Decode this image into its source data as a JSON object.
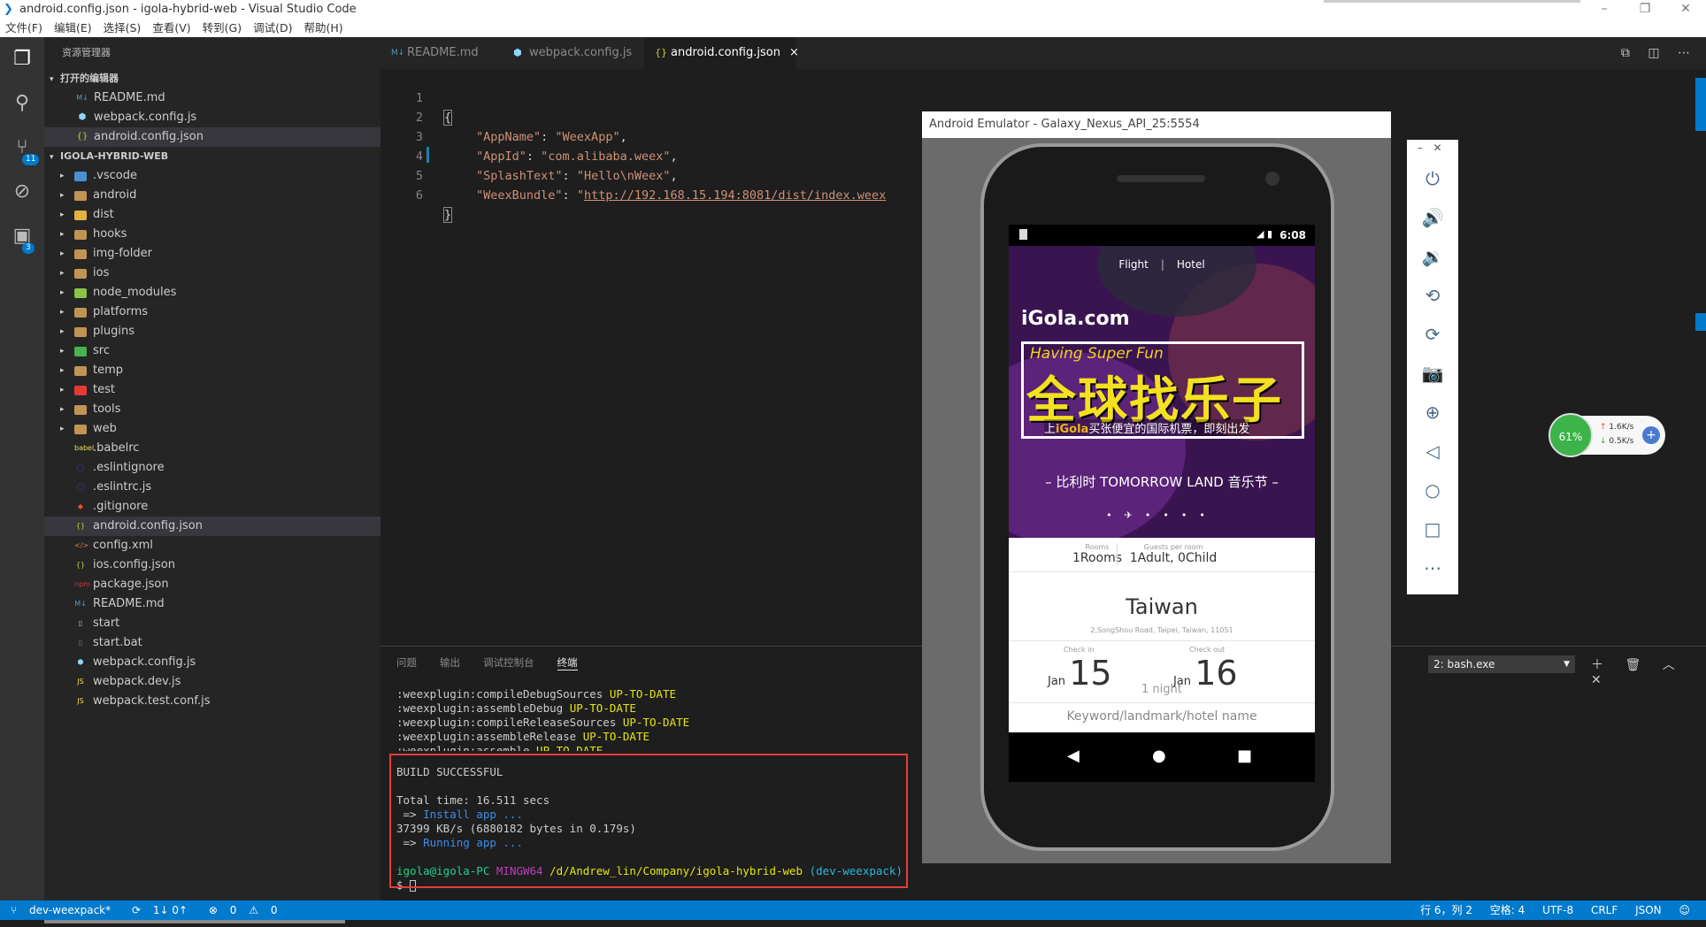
{
  "window": {
    "title": "android.config.json - igola-hybrid-web - Visual Studio Code"
  },
  "menu": [
    "文件(F)",
    "编辑(E)",
    "选择(S)",
    "查看(V)",
    "转到(G)",
    "调试(D)",
    "帮助(H)"
  ],
  "activity": {
    "scm_badge": "11",
    "ext_badge": "3"
  },
  "sidebar": {
    "title": "资源管理器",
    "open_editors_label": "打开的编辑器",
    "open_editors": [
      {
        "name": "README.md",
        "icon": "markdown-icon"
      },
      {
        "name": "webpack.config.js",
        "icon": "webpack-icon"
      },
      {
        "name": "android.config.json",
        "icon": "json-icon"
      }
    ],
    "project_label": "IGOLA-HYBRID-WEB",
    "folders": [
      ".vscode",
      "android",
      "dist",
      "hooks",
      "img-folder",
      "ios",
      "node_modules",
      "platforms",
      "plugins",
      "src",
      "temp",
      "test",
      "tools",
      "web"
    ],
    "files": [
      ".babelrc",
      ".eslintignore",
      ".eslintrc.js",
      ".gitignore",
      "android.config.json",
      "config.xml",
      "ios.config.json",
      "package.json",
      "README.md",
      "start",
      "start.bat",
      "webpack.config.js",
      "webpack.dev.js",
      "webpack.test.conf.js"
    ],
    "file_badges": [
      "babel",
      "",
      "",
      "",
      "{}",
      "</>",
      "{}",
      "npm",
      "M↓",
      "",
      "",
      "",
      "JS",
      "JS"
    ]
  },
  "tabs": [
    {
      "label": "README.md",
      "icon": "M↓"
    },
    {
      "label": "webpack.config.js",
      "icon": "⬢"
    },
    {
      "label": "android.config.json",
      "icon": "{}",
      "close": "×"
    }
  ],
  "editor": {
    "line_numbers": [
      "1",
      "2",
      "3",
      "4",
      "5",
      "6"
    ],
    "open_brace": "{",
    "close_brace": "}",
    "entries": [
      {
        "key": "\"AppName\"",
        "value": "\"WeexApp\"",
        "sep": ","
      },
      {
        "key": "\"AppId\"",
        "value": "\"com.alibaba.weex\"",
        "sep": ","
      },
      {
        "key": "\"SplashText\"",
        "value": "\"Hello\\nWeex\"",
        "sep": ","
      },
      {
        "key": "\"WeexBundle\"",
        "value_prefix": "\"",
        "url": "http://192.168.15.194:8081/dist/index.weex",
        "sep": ""
      }
    ]
  },
  "panel": {
    "tabs": [
      "问题",
      "输出",
      "调试控制台",
      "终端"
    ],
    "terminal_select": "2: bash.exe",
    "terminal": {
      "gradle": [
        {
          "task": ":weexplugin:compileDebugSources",
          "status": "UP-TO-DATE"
        },
        {
          "task": ":weexplugin:assembleDebug",
          "status": "UP-TO-DATE"
        },
        {
          "task": ":weexplugin:compileReleaseSources",
          "status": "UP-TO-DATE"
        },
        {
          "task": ":weexplugin:assembleRelease",
          "status": "UP-TO-DATE"
        },
        {
          "task": ":weexplugin:assemble",
          "status": "UP-TO-DATE"
        }
      ],
      "build": "BUILD SUCCESSFUL",
      "total_time": "Total time: 16.511 secs",
      "arrow": " =>",
      "install": " Install app ...",
      "transfer": "37399 KB/s (6880182 bytes in 0.179s)",
      "running": " Running app ...",
      "prompt_user": "igola@igola-PC",
      "prompt_shell": "MINGW64",
      "prompt_path": "/d/Andrew_lin/Company/igola-hybrid-web",
      "prompt_branch": "(dev-weexpack)",
      "prompt_symbol": "$"
    }
  },
  "statusbar": {
    "branch": "dev-weexpack*",
    "sync": "1↓ 0↑",
    "errors": "0",
    "warnings": "0",
    "position": "行 6，列 2",
    "spaces": "空格: 4",
    "encoding": "UTF-8",
    "eol": "CRLF",
    "language": "JSON"
  },
  "emulator": {
    "title": "Android Emulator - Galaxy_Nexus_API_25:5554",
    "time": "6:08",
    "seg_flight": "Flight",
    "seg_hotel": "Hotel",
    "brand": "iGola.com",
    "slogan_en": "Having Super Fun",
    "slogan_cn": "全球找乐子",
    "sub_prefix": "上",
    "sub_brand": "iGola",
    "sub_suffix": "买张便宜的国际机票，即刻出发",
    "event": "– 比利时 TOMORROW LAND 音乐节 –",
    "rooms_cap": "Rooms",
    "rooms_val": "1Rooms",
    "guests_cap": "Guests per room",
    "guests_val": "1Adult, 0Child",
    "city": "Taiwan",
    "address": "2,SongShou Road, Taipei, Taiwan, 11051",
    "checkin_cap": "Check in",
    "checkin_mon": "Jan",
    "checkin_day": "15",
    "nights": "1 night",
    "checkout_cap": "Check out",
    "checkout_mon": "Jan",
    "checkout_day": "16",
    "keyword_placeholder": "Keyword/landmark/hotel name"
  },
  "netwidget": {
    "percent": "61%",
    "up": "1.6K/s",
    "down": "0.5K/s"
  }
}
